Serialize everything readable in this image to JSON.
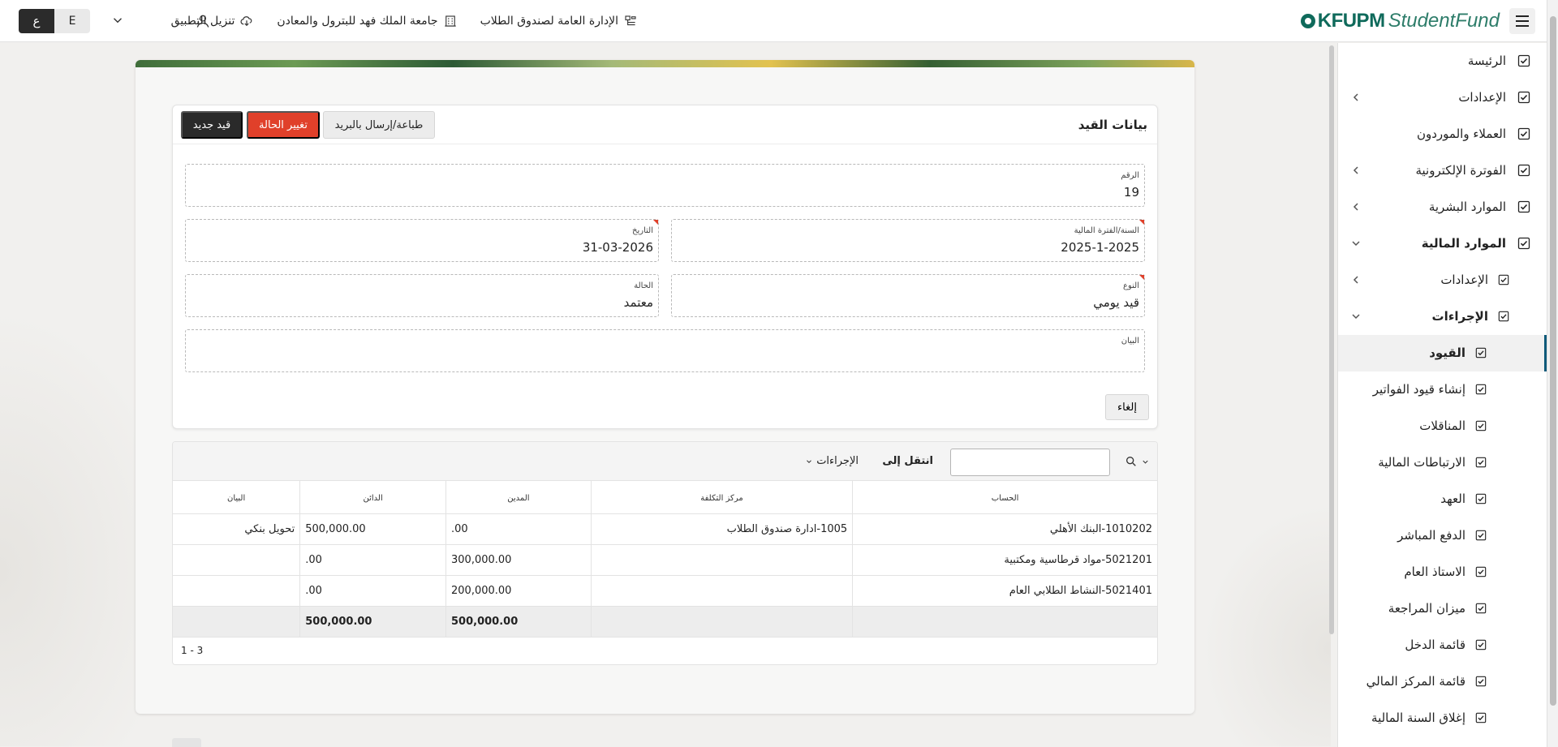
{
  "topbar": {
    "logo_part1": "KFUPM",
    "logo_part2": "StudentFund",
    "download_app": "تنزيل التطبيق",
    "university": "جامعة الملك فهد للبترول والمعادن",
    "department": "الإدارة العامة لصندوق الطلاب",
    "lang_ar": "ع",
    "lang_en": "E"
  },
  "sidebar": {
    "items": [
      {
        "label": "الرئيسة"
      },
      {
        "label": "الإعدادات"
      },
      {
        "label": "العملاء والموردون"
      },
      {
        "label": "الفوترة الإلكترونية"
      },
      {
        "label": "الموارد البشرية"
      },
      {
        "label": "الموارد المالية"
      },
      {
        "label": "الإعدادات"
      },
      {
        "label": "الإجراءات"
      },
      {
        "label": "القيود"
      },
      {
        "label": "إنشاء قيود الفواتير"
      },
      {
        "label": "المناقلات"
      },
      {
        "label": "الارتباطات المالية"
      },
      {
        "label": "العهد"
      },
      {
        "label": "الدفع المباشر"
      },
      {
        "label": "الاستاذ العام"
      },
      {
        "label": "ميزان المراجعة"
      },
      {
        "label": "قائمة الدخل"
      },
      {
        "label": "قائمة المركز المالي"
      },
      {
        "label": "إغلاق السنة المالية"
      }
    ]
  },
  "form": {
    "title": "بيانات القيد",
    "btn_new": "قيد جديد",
    "btn_change_status": "تغيير الحالة",
    "btn_print": "طباعة/إرسال بالبريد",
    "number_label": "الرقم",
    "number_value": "19",
    "period_label": "السنة/الفترة المالية",
    "period_value": "2025-1-2025",
    "date_label": "التاريخ",
    "date_value": "31-03-2026",
    "type_label": "النوع",
    "type_value": "قيد يومي",
    "status_label": "الحالة",
    "status_value": "معتمد",
    "description_label": "البيان",
    "description_value": "",
    "cancel": "إلغاء"
  },
  "grid": {
    "search_value": "",
    "goto_label": "انتقل إلى",
    "actions_label": "الإجراءات",
    "columns": [
      "الحساب",
      "مركز التكلفة",
      "المدين",
      "الدائن",
      "البيان"
    ],
    "rows": [
      {
        "account": "1010202-البنك الأهلي",
        "cost_center": "1005-ادارة صندوق الطلاب",
        "debit": ".00",
        "credit": "500,000.00",
        "description": "تحويل بنكي"
      },
      {
        "account": "5021201-مواد قرطاسية ومكتبية",
        "cost_center": "",
        "debit": "300,000.00",
        "credit": ".00",
        "description": ""
      },
      {
        "account": "5021401-النشاط الطلابي العام",
        "cost_center": "",
        "debit": "200,000.00",
        "credit": ".00",
        "description": ""
      }
    ],
    "totals": {
      "debit": "500,000.00",
      "credit": "500,000.00"
    },
    "pagination": "1 - 3"
  }
}
